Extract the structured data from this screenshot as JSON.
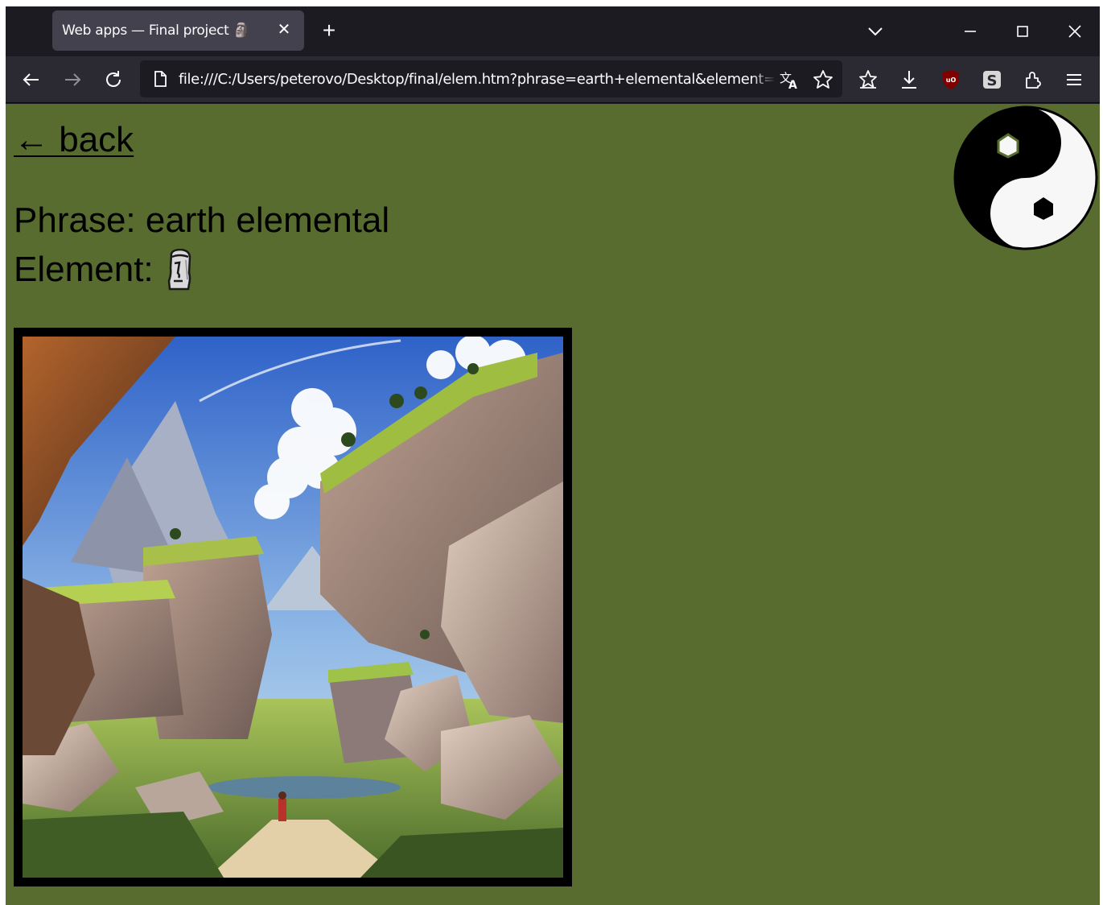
{
  "browser": {
    "tab_title": "Web apps — Final project 🗿",
    "tab_close": "✕",
    "new_tab": "+",
    "url": "file:///C:/Users/peterovo/Desktop/final/elem.htm?phrase=earth+elemental&element=",
    "icons": [
      "back-arrow-icon",
      "forward-arrow-icon",
      "reload-icon",
      "page-icon",
      "translate-icon",
      "bookmark-star-icon",
      "pocket-icon",
      "download-icon",
      "ublock-icon",
      "s-extension-icon",
      "extensions-icon",
      "menu-icon"
    ]
  },
  "page": {
    "back_label": "← back",
    "phrase_label": "Phrase: earth elemental",
    "element_label": "Element:",
    "element_emoji_name": "moai-icon",
    "logo_name": "yin-yang-icon",
    "background_color": "#586c30"
  }
}
